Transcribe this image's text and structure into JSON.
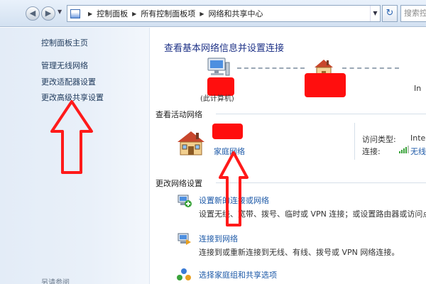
{
  "address_bar": {
    "breadcrumbs": [
      "控制面板",
      "所有控制面板项",
      "网络和共享中心"
    ],
    "search_placeholder": "搜索控"
  },
  "sidebar": {
    "home": "控制面板主页",
    "links": [
      "管理无线网络",
      "更改适配器设置",
      "更改高级共享设置"
    ],
    "see_also": "另请参阅"
  },
  "main": {
    "title": "查看基本网络信息并设置连接",
    "map": {
      "this_computer": "(此计算机)",
      "peer_text": "In"
    },
    "active_section": "查看活动网络",
    "active_network": {
      "type": "家庭网络",
      "access_type_label": "访问类型:",
      "access_type_value": "Inte",
      "connection_label": "连接:",
      "connection_value": "无线"
    },
    "change_section": "更改网络设置",
    "tasks": [
      {
        "link": "设置新的连接或网络",
        "desc": "设置无线、宽带、拨号、临时或 VPN 连接；或设置路由器或访问点"
      },
      {
        "link": "连接到网络",
        "desc": "连接到或重新连接到无线、有线、拨号或 VPN 网络连接。"
      },
      {
        "link": "选择家庭组和共享选项",
        "desc": ""
      }
    ]
  },
  "colors": {
    "link": "#1e5aa8",
    "title": "#1e3287",
    "annotation_red": "#ff0e0e",
    "sidebar_bg": "#e3ecf7"
  },
  "icons": [
    "back-icon",
    "forward-icon",
    "control-panel-icon",
    "refresh-icon",
    "computer-icon",
    "network-icon",
    "house-icon",
    "wifi-signal-icon",
    "network-setup-icon",
    "network-connect-icon",
    "homegroup-icon"
  ]
}
